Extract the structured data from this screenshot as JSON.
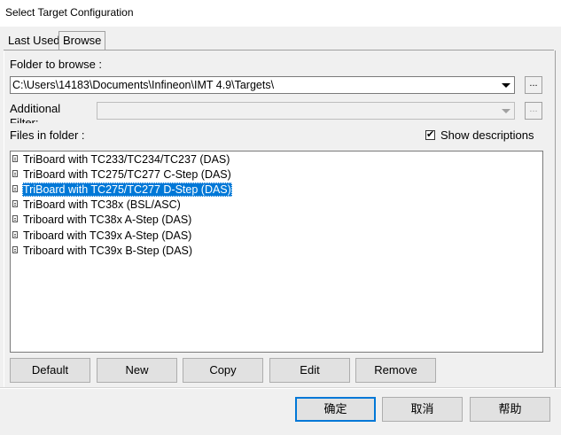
{
  "window": {
    "title": "Select Target Configuration"
  },
  "tabs": [
    {
      "label": "Last Used",
      "active": false
    },
    {
      "label": "Browse",
      "active": true
    }
  ],
  "browse": {
    "folder_label": "Folder to browse :",
    "folder_value": "C:\\Users\\14183\\Documents\\Infineon\\IMT 4.9\\Targets\\",
    "ellipsis": "...",
    "additional_label_line1": "Additional",
    "additional_label_line2": "Filter:",
    "additional_value": "",
    "files_label": "Files in folder :",
    "show_descriptions_label": "Show descriptions",
    "show_descriptions_checked": true,
    "files": [
      {
        "label": "TriBoard with TC233/TC234/TC237 (DAS)",
        "selected": false
      },
      {
        "label": "TriBoard with TC275/TC277 C-Step (DAS)",
        "selected": false
      },
      {
        "label": "TriBoard with TC275/TC277 D-Step (DAS)",
        "selected": true
      },
      {
        "label": "TriBoard with TC38x (BSL/ASC)",
        "selected": false
      },
      {
        "label": "Triboard with TC38x A-Step (DAS)",
        "selected": false
      },
      {
        "label": "Triboard with TC39x A-Step (DAS)",
        "selected": false
      },
      {
        "label": "Triboard with TC39x B-Step (DAS)",
        "selected": false
      }
    ],
    "buttons": {
      "default": "Default",
      "new": "New",
      "copy": "Copy",
      "edit": "Edit",
      "remove": "Remove"
    }
  },
  "footer": {
    "ok": "确定",
    "cancel": "取消",
    "help": "帮助"
  },
  "colors": {
    "selection": "#0078d7",
    "window_bg": "#f0f0f0"
  }
}
